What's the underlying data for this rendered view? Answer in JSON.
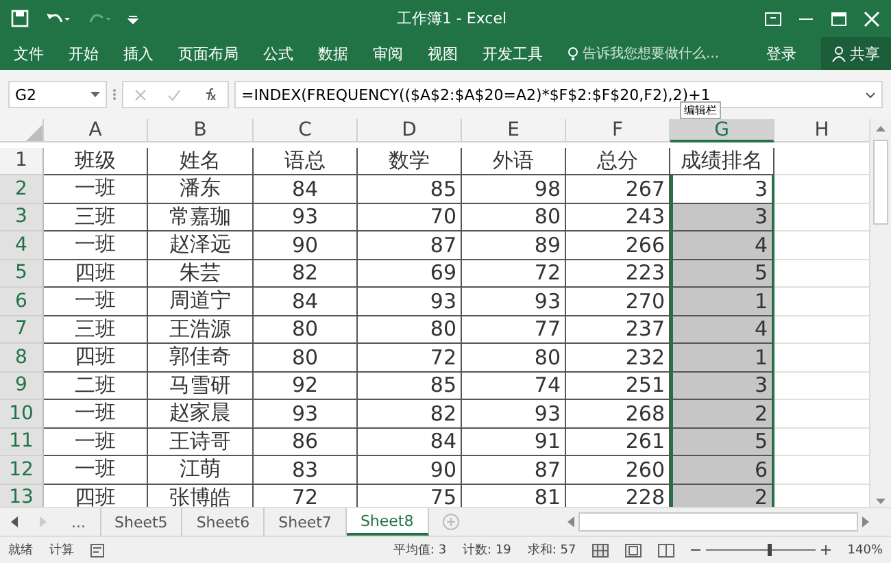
{
  "window": {
    "title": "工作簿1 - Excel"
  },
  "ribbon": {
    "tabs": [
      "文件",
      "开始",
      "插入",
      "页面布局",
      "公式",
      "数据",
      "审阅",
      "视图",
      "开发工具"
    ],
    "tell_me": "告诉我您想要做什么...",
    "sign_in": "登录",
    "share": "共享"
  },
  "formula_bar": {
    "name_box": "G2",
    "formula": "=INDEX(FREQUENCY(($A$2:$A$20=A2)*$F$2:$F$20,F2),2)+1",
    "tooltip": "编辑栏"
  },
  "sheet": {
    "columns": [
      {
        "label": "A",
        "selected": false
      },
      {
        "label": "B",
        "selected": false
      },
      {
        "label": "C",
        "selected": false
      },
      {
        "label": "D",
        "selected": false
      },
      {
        "label": "E",
        "selected": false
      },
      {
        "label": "F",
        "selected": false
      },
      {
        "label": "G",
        "selected": true
      },
      {
        "label": "H",
        "selected": false
      }
    ],
    "rows": [
      {
        "number": "1",
        "selected": false,
        "cells": [
          "班级",
          "姓名",
          "语总",
          "数学",
          "外语",
          "总分",
          "成绩排名",
          ""
        ]
      },
      {
        "number": "2",
        "selected": true,
        "active": true,
        "cells": [
          "一班",
          "潘东",
          "84",
          "85",
          "98",
          "267",
          "3",
          ""
        ]
      },
      {
        "number": "3",
        "selected": true,
        "cells": [
          "三班",
          "常嘉珈",
          "93",
          "70",
          "80",
          "243",
          "3",
          ""
        ]
      },
      {
        "number": "4",
        "selected": true,
        "cells": [
          "一班",
          "赵泽远",
          "90",
          "87",
          "89",
          "266",
          "4",
          ""
        ]
      },
      {
        "number": "5",
        "selected": true,
        "cells": [
          "四班",
          "朱芸",
          "82",
          "69",
          "72",
          "223",
          "5",
          ""
        ]
      },
      {
        "number": "6",
        "selected": true,
        "cells": [
          "一班",
          "周道宁",
          "84",
          "93",
          "93",
          "270",
          "1",
          ""
        ]
      },
      {
        "number": "7",
        "selected": true,
        "cells": [
          "三班",
          "王浩源",
          "80",
          "80",
          "77",
          "237",
          "4",
          ""
        ]
      },
      {
        "number": "8",
        "selected": true,
        "cells": [
          "四班",
          "郭佳奇",
          "80",
          "72",
          "80",
          "232",
          "1",
          ""
        ]
      },
      {
        "number": "9",
        "selected": true,
        "cells": [
          "二班",
          "马雪研",
          "92",
          "85",
          "74",
          "251",
          "3",
          ""
        ]
      },
      {
        "number": "10",
        "selected": true,
        "cells": [
          "一班",
          "赵家晨",
          "93",
          "82",
          "93",
          "268",
          "2",
          ""
        ]
      },
      {
        "number": "11",
        "selected": true,
        "cells": [
          "一班",
          "王诗哥",
          "86",
          "84",
          "91",
          "261",
          "5",
          ""
        ]
      },
      {
        "number": "12",
        "selected": true,
        "cells": [
          "一班",
          "江萌",
          "83",
          "90",
          "87",
          "260",
          "6",
          ""
        ]
      },
      {
        "number": "13",
        "selected": true,
        "cells": [
          "四班",
          "张博皓",
          "72",
          "75",
          "81",
          "228",
          "2",
          ""
        ]
      }
    ]
  },
  "sheet_tabs": [
    {
      "label": "...",
      "selected": false
    },
    {
      "label": "Sheet5",
      "selected": false
    },
    {
      "label": "Sheet6",
      "selected": false
    },
    {
      "label": "Sheet7",
      "selected": false
    },
    {
      "label": "Sheet8",
      "selected": true
    }
  ],
  "status_bar": {
    "ready": "就绪",
    "calc": "计算",
    "stats": [
      "平均值: 3",
      "计数: 19",
      "求和: 57"
    ],
    "zoom": "140%",
    "zoom_slider": {
      "level": 0.56
    }
  }
}
